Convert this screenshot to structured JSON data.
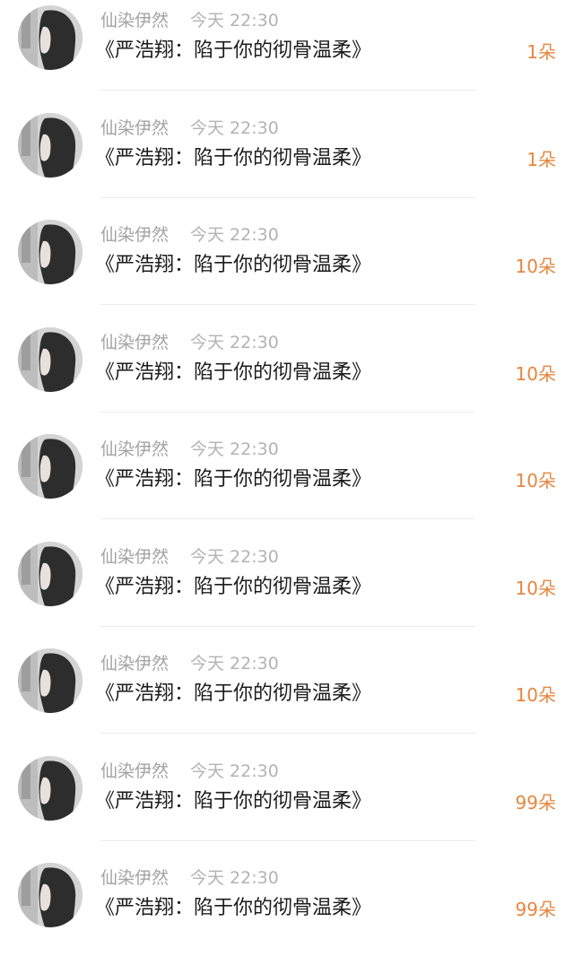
{
  "messages": [
    {
      "name": "仙染伊然",
      "time": "今天 22:30",
      "title": "《严浩翔：陷于你的彻骨温柔》",
      "gift": "1朵"
    },
    {
      "name": "仙染伊然",
      "time": "今天 22:30",
      "title": "《严浩翔：陷于你的彻骨温柔》",
      "gift": "1朵"
    },
    {
      "name": "仙染伊然",
      "time": "今天 22:30",
      "title": "《严浩翔：陷于你的彻骨温柔》",
      "gift": "10朵"
    },
    {
      "name": "仙染伊然",
      "time": "今天 22:30",
      "title": "《严浩翔：陷于你的彻骨温柔》",
      "gift": "10朵"
    },
    {
      "name": "仙染伊然",
      "time": "今天 22:30",
      "title": "《严浩翔：陷于你的彻骨温柔》",
      "gift": "10朵"
    },
    {
      "name": "仙染伊然",
      "time": "今天 22:30",
      "title": "《严浩翔：陷于你的彻骨温柔》",
      "gift": "10朵"
    },
    {
      "name": "仙染伊然",
      "time": "今天 22:30",
      "title": "《严浩翔：陷于你的彻骨温柔》",
      "gift": "10朵"
    },
    {
      "name": "仙染伊然",
      "time": "今天 22:30",
      "title": "《严浩翔：陷于你的彻骨温柔》",
      "gift": "99朵"
    },
    {
      "name": "仙染伊然",
      "time": "今天 22:30",
      "title": "《严浩翔：陷于你的彻骨温柔》",
      "gift": "99朵"
    }
  ],
  "colors": {
    "name": "#a3a3a3",
    "time": "#b3b3b3",
    "title": "#1c1c1c",
    "gift": "#e6863f",
    "divider": "#ececec"
  },
  "icons": {
    "avatar": "avatar-photo-girl-long-dark-hair"
  }
}
